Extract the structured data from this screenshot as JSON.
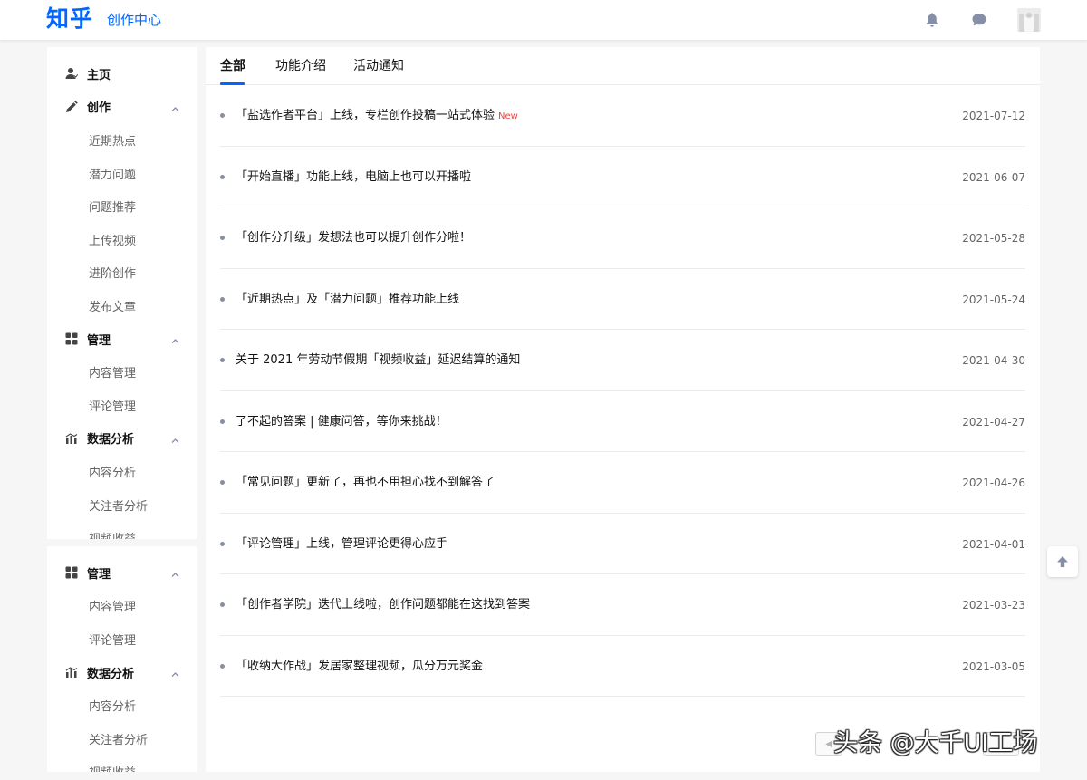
{
  "header": {
    "logo": "知乎",
    "subtitle": "创作中心",
    "icons": [
      "bell-icon",
      "chat-icon"
    ]
  },
  "sidebar_top": {
    "home": "主页",
    "create": {
      "label": "创作",
      "items": [
        "近期热点",
        "潜力问题",
        "问题推荐",
        "上传视频",
        "进阶创作",
        "发布文章"
      ]
    },
    "manage": {
      "label": "管理",
      "items": [
        "内容管理",
        "评论管理"
      ]
    },
    "analytics": {
      "label": "数据分析",
      "items": [
        "内容分析",
        "关注者分析",
        "视频收益"
      ]
    }
  },
  "sidebar_bottom": {
    "manage": {
      "label": "管理",
      "items": [
        "内容管理",
        "评论管理"
      ]
    },
    "analytics": {
      "label": "数据分析",
      "items": [
        "内容分析",
        "关注者分析",
        "视频收益"
      ]
    }
  },
  "tabs": [
    "全部",
    "功能介绍",
    "活动通知"
  ],
  "announcements": [
    {
      "title": "「盐选作者平台」上线，专栏创作投稿一站式体验",
      "badge": "New",
      "date": "2021-07-12"
    },
    {
      "title": "「开始直播」功能上线，电脑上也可以开播啦",
      "badge": "",
      "date": "2021-06-07"
    },
    {
      "title": "「创作分升级」发想法也可以提升创作分啦！",
      "badge": "",
      "date": "2021-05-28"
    },
    {
      "title": "「近期热点」及「潜力问题」推荐功能上线",
      "badge": "",
      "date": "2021-05-24"
    },
    {
      "title": "关于 2021 年劳动节假期「视频收益」延迟结算的通知",
      "badge": "",
      "date": "2021-04-30"
    },
    {
      "title": "了不起的答案 | 健康问答，等你来挑战！",
      "badge": "",
      "date": "2021-04-27"
    },
    {
      "title": "「常见问题」更新了，再也不用担心找不到解答了",
      "badge": "",
      "date": "2021-04-26"
    },
    {
      "title": "「评论管理」上线，管理评论更得心应手",
      "badge": "",
      "date": "2021-04-01"
    },
    {
      "title": "「创作者学院」迭代上线啦，创作问题都能在这找到答案",
      "badge": "",
      "date": "2021-03-23"
    },
    {
      "title": "「收纳大作战」发居家整理视频，瓜分万元奖金",
      "badge": "",
      "date": "2021-03-05"
    }
  ],
  "watermark": "头条 @大千UI工场",
  "colors": {
    "brand": "#0066ff",
    "new_badge": "#f1403c",
    "muted": "#8590a6"
  }
}
